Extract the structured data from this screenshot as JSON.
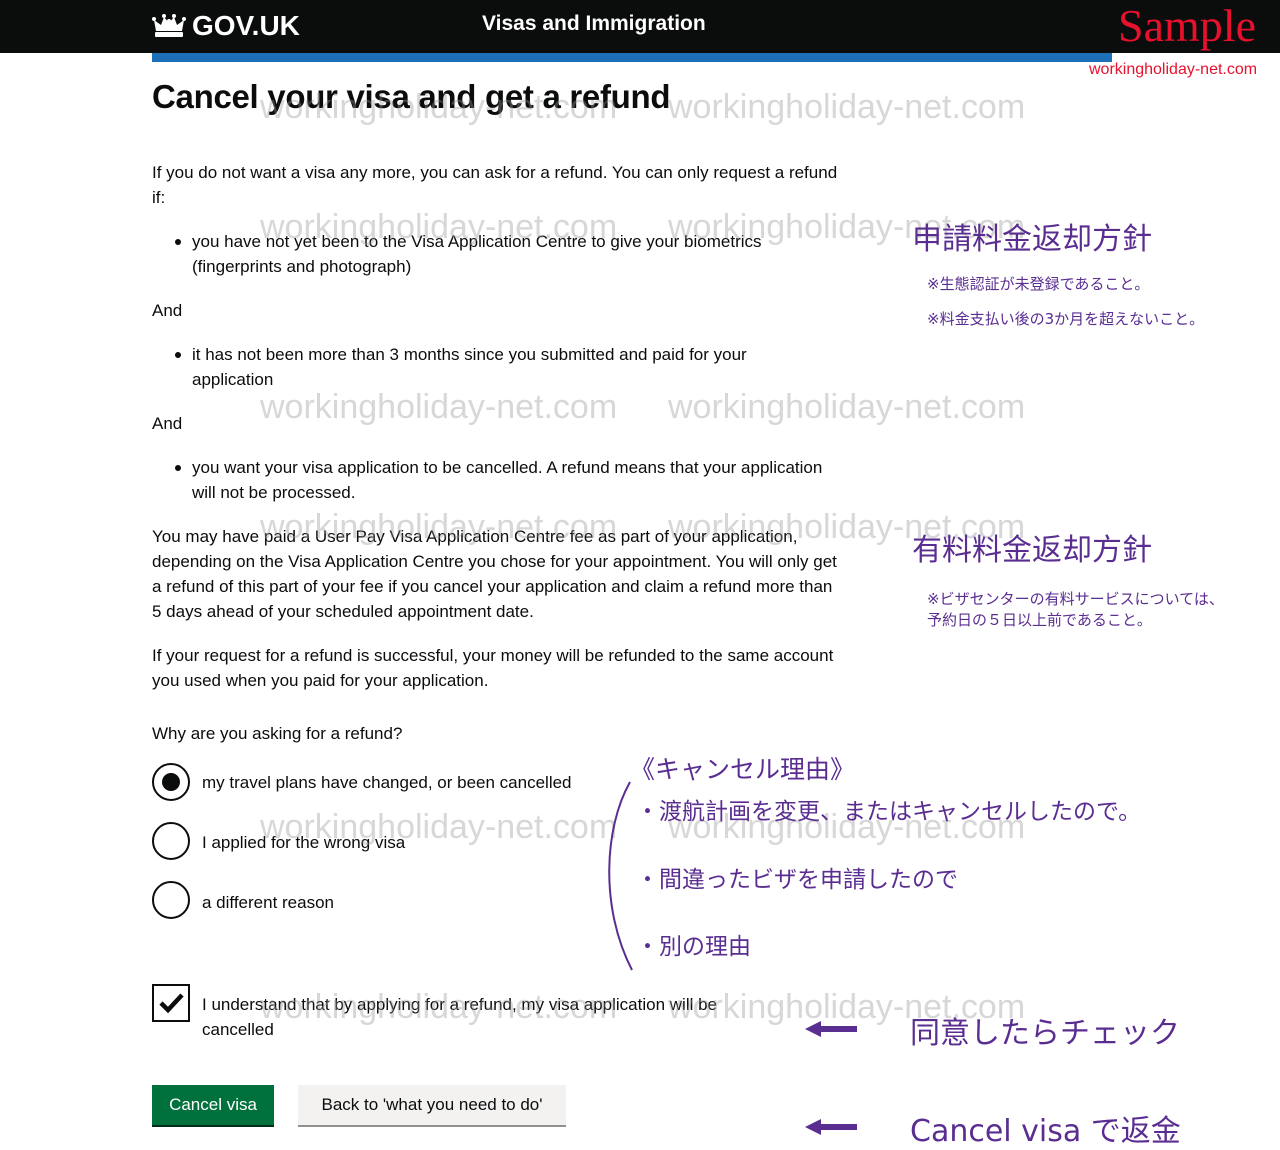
{
  "header": {
    "logo_text": "GOV.UK",
    "service_name": "Visas and Immigration"
  },
  "sample_label": "Sample",
  "site_label": "workingholiday-net.com",
  "page": {
    "title": "Cancel your visa and get a refund",
    "intro": "If you do not want a visa any more, you can ask for a refund. You can only request a refund if:",
    "condition_1": "you have not yet been to the Visa Application Centre to give your biometrics (fingerprints and photograph)",
    "and_1": "And",
    "condition_2": "it has not been more than 3 months since you submitted and paid for your application",
    "and_2": "And",
    "condition_3": "you want your visa application to be cancelled. A refund means that your application will not be processed.",
    "user_pay_note": "You may have paid a User Pay Visa Application Centre fee as part of your application, depending on the Visa Application Centre you chose for your appointment. You will only get a refund of this part of your fee if you cancel your application and claim a refund more than 5 days ahead of your scheduled appointment date.",
    "refund_note": "If your request for a refund is successful, your money will be refunded to the same account you used when you paid for your application."
  },
  "form": {
    "question": "Why are you asking for a refund?",
    "options": [
      {
        "label": "my travel plans have changed, or been cancelled",
        "selected": true
      },
      {
        "label": "I applied for the wrong visa",
        "selected": false
      },
      {
        "label": "a different reason",
        "selected": false
      }
    ],
    "confirm_label": "I understand that by applying for a refund, my visa application will be cancelled",
    "confirm_checked": true,
    "cancel_button": "Cancel visa",
    "back_button": "Back to 'what you need to do'"
  },
  "annotations": {
    "refund_policy_title": "申請料金返却方針",
    "refund_policy_note_1": "※生態認証が未登録であること。",
    "refund_policy_note_2": "※料金支払い後の3か月を超えないこと。",
    "paid_policy_title": "有料料金返却方針",
    "paid_policy_note_1": "※ビザセンターの有料サービスについては、",
    "paid_policy_note_2": "予約日の５日以上前であること。",
    "reasons_title": "《キャンセル理由》",
    "reason_1": "・渡航計画を変更、またはキャンセルしたので。",
    "reason_2": "・間違ったビザを申請したので",
    "reason_3": "・別の理由",
    "check_hint": "同意したらチェック",
    "cancel_hint": "Cancel visa で返金"
  },
  "colors": {
    "header_bg": "#0b0c0c",
    "brand_blue": "#1d70b8",
    "primary_button": "#00703c",
    "annotation": "#5a2d91",
    "sample_red": "#e8112d"
  }
}
